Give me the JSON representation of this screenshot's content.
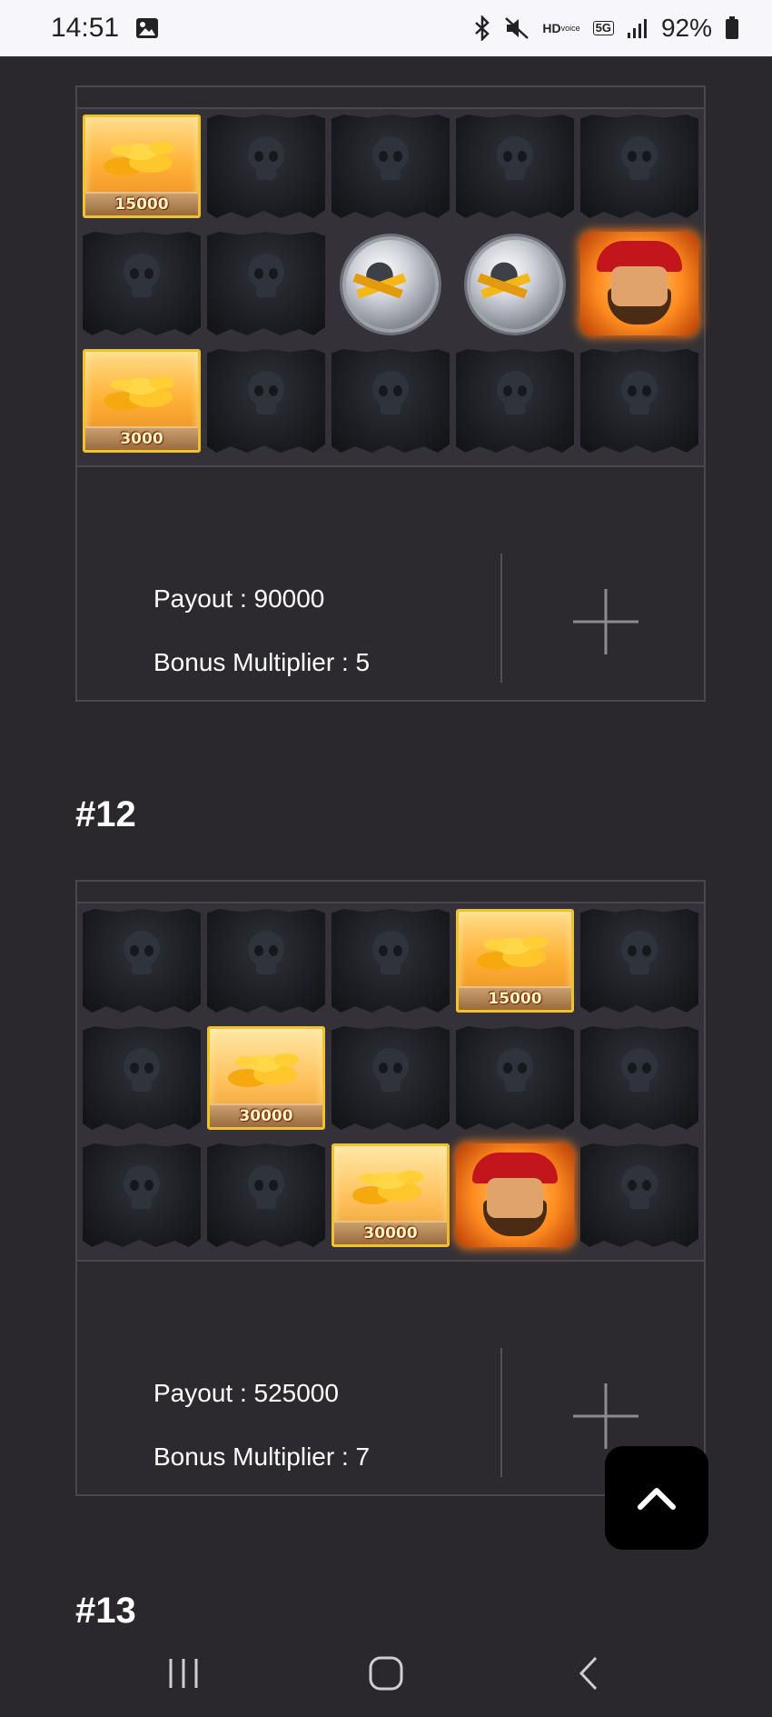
{
  "status_bar": {
    "time": "14:51",
    "hd_label": "HD",
    "hd_sub": "voice",
    "network": "5G",
    "battery_percent": "92%",
    "icons": [
      "gallery-icon",
      "bluetooth-icon",
      "mute-icon",
      "hd-voice-icon",
      "5g-icon",
      "signal-icon",
      "battery-icon"
    ]
  },
  "results": [
    {
      "title": "",
      "grid": [
        [
          {
            "type": "gold",
            "amount": "15000"
          },
          {
            "type": "flag"
          },
          {
            "type": "flag"
          },
          {
            "type": "flag"
          },
          {
            "type": "flag"
          }
        ],
        [
          {
            "type": "flag"
          },
          {
            "type": "flag"
          },
          {
            "type": "silver-coin"
          },
          {
            "type": "silver-coin"
          },
          {
            "type": "pirate"
          }
        ],
        [
          {
            "type": "gold-small",
            "amount": "3000"
          },
          {
            "type": "flag"
          },
          {
            "type": "flag"
          },
          {
            "type": "flag"
          },
          {
            "type": "flag"
          }
        ]
      ],
      "payout_label": "Payout : 90000",
      "bonus_label": "Bonus Multiplier : 5"
    },
    {
      "title": "#12",
      "grid": [
        [
          {
            "type": "flag"
          },
          {
            "type": "flag"
          },
          {
            "type": "flag"
          },
          {
            "type": "gold",
            "amount": "15000"
          },
          {
            "type": "flag"
          }
        ],
        [
          {
            "type": "flag"
          },
          {
            "type": "chest",
            "amount": "30000"
          },
          {
            "type": "flag"
          },
          {
            "type": "flag"
          },
          {
            "type": "flag"
          }
        ],
        [
          {
            "type": "flag"
          },
          {
            "type": "flag"
          },
          {
            "type": "chest",
            "amount": "30000"
          },
          {
            "type": "pirate"
          },
          {
            "type": "flag"
          }
        ]
      ],
      "payout_label": "Payout : 525000",
      "bonus_label": "Bonus Multiplier : 7"
    },
    {
      "title": "#13"
    }
  ],
  "colors": {
    "background": "#2a282c",
    "card_border": "#4a484e",
    "gold_border": "#f2c22a"
  }
}
